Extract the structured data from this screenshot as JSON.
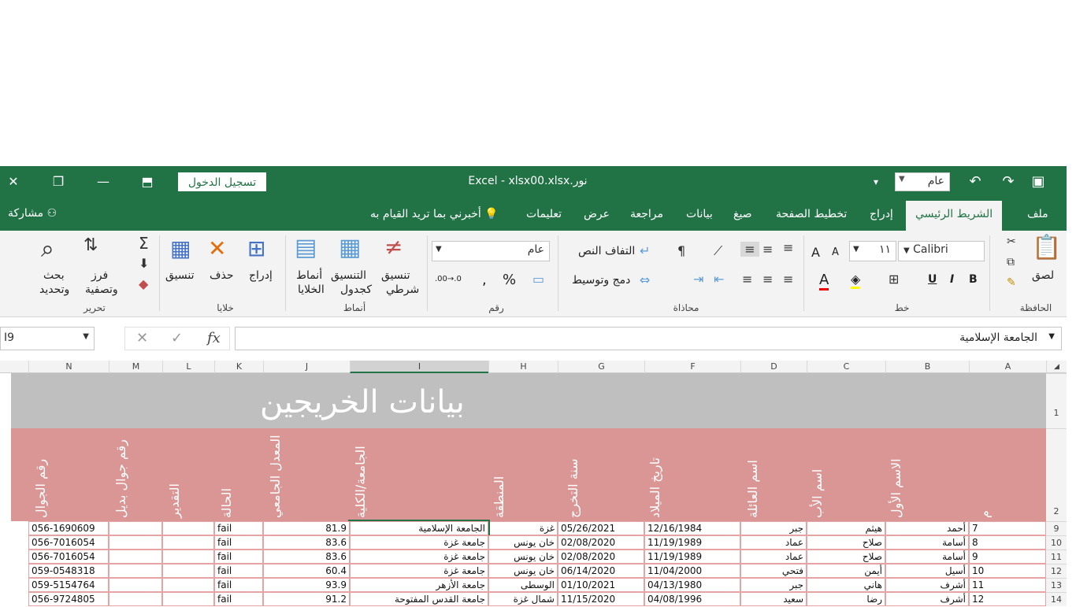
{
  "titlebar": {
    "title": "Excel  -  xlsx00.xlsx.نور",
    "login_label": "تسجيل الدخول",
    "quick_access_value": "عام"
  },
  "tabs": {
    "file": "ملف",
    "home": "الشريط الرئيسي",
    "insert": "إدراج",
    "page_layout": "تخطيط الصفحة",
    "formulas": "صيغ",
    "data": "بيانات",
    "review": "مراجعة",
    "view": "عرض",
    "help": "تعليمات",
    "tell_me": "أخبرني بما تريد القيام به",
    "share": "مشاركة"
  },
  "ribbon": {
    "clipboard": {
      "paste": "لصق",
      "label": "الحافظة"
    },
    "font": {
      "name": "Calibri",
      "size": "١١",
      "label": "خط"
    },
    "alignment": {
      "wrap": "التفاف النص",
      "merge": "دمج وتوسيط",
      "label": "محاذاة"
    },
    "number": {
      "format": "عام",
      "label": "رقم"
    },
    "styles": {
      "conditional_line1": "تنسيق",
      "conditional_line2": "شرطي",
      "table_line1": "التنسيق",
      "table_line2": "كجدول",
      "cell_line1": "أنماط",
      "cell_line2": "الخلايا",
      "label": "أنماط"
    },
    "cells": {
      "insert": "إدراج",
      "delete": "حذف",
      "format": "تنسيق",
      "label": "خلايا"
    },
    "editing": {
      "sort_line1": "فرز",
      "sort_line2": "وتصفية",
      "find_line1": "بحث",
      "find_line2": "وتحديد",
      "label": "تحرير"
    }
  },
  "formula_bar": {
    "name_box": "I9",
    "content": "الجامعة الإسلامية"
  },
  "columns": [
    "A",
    "B",
    "C",
    "D",
    "F",
    "G",
    "H",
    "I",
    "J",
    "K",
    "L",
    "M",
    "N"
  ],
  "sheet": {
    "title": "بيانات الخريجين",
    "headers": [
      "م",
      "الاسم الأول",
      "اسم الأب",
      "اسم العائلة",
      "تاريخ الميلاد",
      "سنة التخرج",
      "المنطقة",
      "الجامعة/الكلية",
      "المعدل الجامعي",
      "الحالة",
      "التقدير",
      "رقم جوال بديل",
      "رقم الجوال"
    ],
    "rows": [
      {
        "row": "9",
        "a": "7",
        "b": "أحمد",
        "c": "هيثم",
        "d": "جبر",
        "f": "12/16/1984",
        "g": "05/26/2021",
        "h": "غزة",
        "i": "الجامعة الإسلامية",
        "j": "81.9",
        "k": "fail",
        "n": "056-1690609"
      },
      {
        "row": "10",
        "a": "8",
        "b": "أسامة",
        "c": "صلاح",
        "d": "عماد",
        "f": "11/19/1989",
        "g": "02/08/2020",
        "h": "خان يونس",
        "i": "جامعة غزة",
        "j": "83.6",
        "k": "fail",
        "n": "056-7016054"
      },
      {
        "row": "11",
        "a": "9",
        "b": "أسامة",
        "c": "صلاح",
        "d": "عماد",
        "f": "11/19/1989",
        "g": "02/08/2020",
        "h": "خان يونس",
        "i": "جامعة غزة",
        "j": "83.6",
        "k": "fail",
        "n": "056-7016054"
      },
      {
        "row": "12",
        "a": "10",
        "b": "أسيل",
        "c": "أيمن",
        "d": "فتحي",
        "f": "11/04/2000",
        "g": "06/14/2020",
        "h": "خان يونس",
        "i": "جامعة غزة",
        "j": "60.4",
        "k": "fail",
        "n": "059-0548318"
      },
      {
        "row": "13",
        "a": "11",
        "b": "أشرف",
        "c": "هاني",
        "d": "جبر",
        "f": "04/13/1980",
        "g": "01/10/2021",
        "h": "الوسطى",
        "i": "جامعة الأزهر",
        "j": "93.9",
        "k": "fail",
        "n": "059-5154764"
      },
      {
        "row": "14",
        "a": "12",
        "b": "أشرف",
        "c": "رضا",
        "d": "سعيد",
        "f": "04/08/1996",
        "g": "11/15/2020",
        "h": "شمال غزة",
        "i": "جامعة القدس المفتوحة",
        "j": "91.2",
        "k": "fail",
        "n": "056-9724805"
      }
    ]
  },
  "colors": {
    "excel_green": "#217346",
    "title_band": "#bfbfbf",
    "header_band": "#da9694"
  }
}
